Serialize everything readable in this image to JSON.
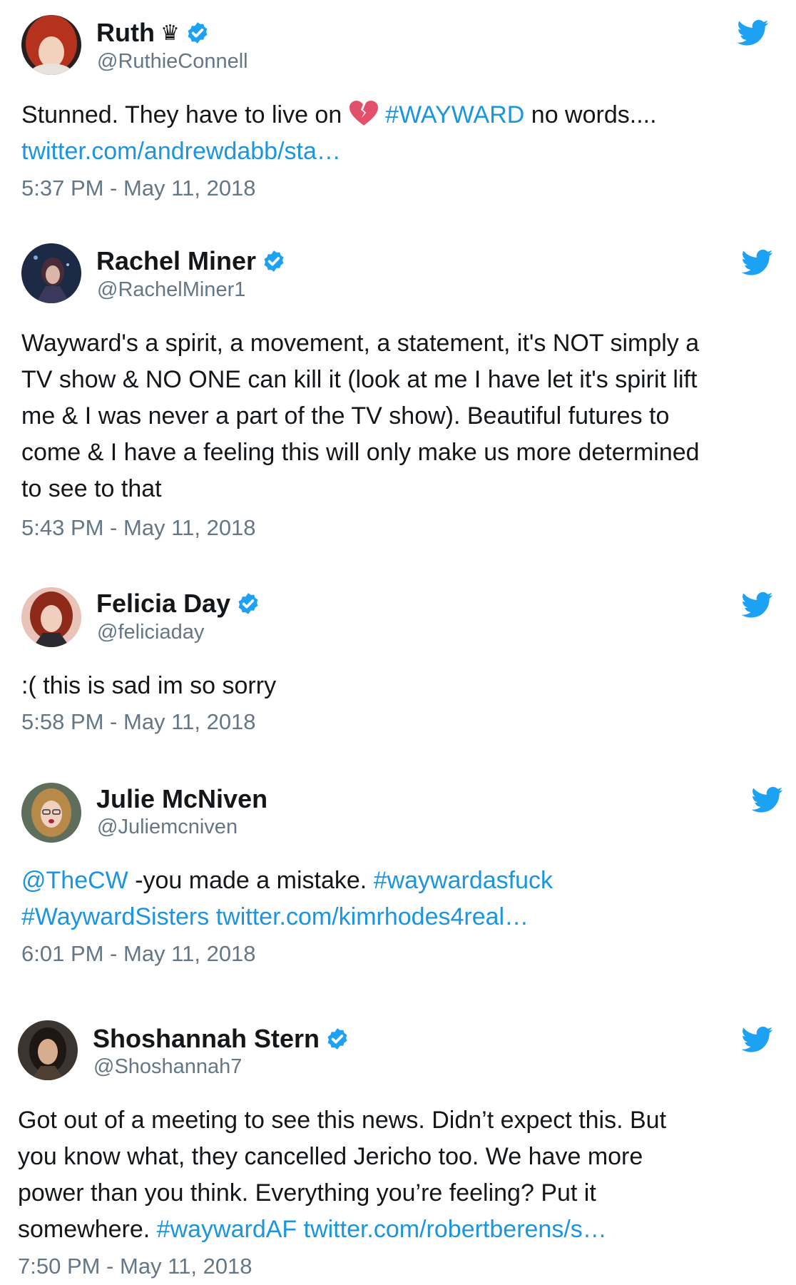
{
  "tweets": [
    {
      "name": "Ruth",
      "name_suffix": "♛",
      "handle": "@RuthieConnell",
      "text_1a": "Stunned. They have to live on",
      "hashtag_1": "#WAYWARD",
      "text_1b": "no words....",
      "link_1": "twitter.com/andrewdabb/sta…",
      "time": "5:37 PM - May 11, 2018"
    },
    {
      "name": "Rachel Miner",
      "handle": "@RachelMiner1",
      "lines": [
        "Wayward's a spirit, a movement, a statement, it's NOT simply a",
        "TV show & NO ONE can kill it (look at me I have let it's spirit lift",
        "me & I was never a part of the TV show). Beautiful futures to",
        "come & I have a feeling this will only make us more determined",
        "to see to that"
      ],
      "time": "5:43 PM - May 11, 2018"
    },
    {
      "name": "Felicia Day",
      "handle": "@feliciaday",
      "text": ":( this is sad im so sorry",
      "time": "5:58 PM - May 11, 2018"
    },
    {
      "name": "Julie McNiven",
      "handle": "@Juliemcniven",
      "mention": "@TheCW",
      "text_1": "-you made a mistake.",
      "hashtag_1": "#waywardasfuck",
      "hashtag_2": "#WaywardSisters",
      "link": "twitter.com/kimrhodes4real…",
      "time": "6:01 PM - May 11, 2018"
    },
    {
      "name": "Shoshannah Stern",
      "handle": "@Shoshannah7",
      "lines": [
        "Got out of a meeting to see this news. Didn’t expect this. But",
        "you know what, they cancelled Jericho too. We have more",
        "power than you think. Everything you’re feeling? Put it"
      ],
      "text_last": "somewhere.",
      "hashtag": "#waywardAF",
      "link": "twitter.com/robertberens/s…",
      "time": "7:50 PM - May 11, 2018"
    }
  ],
  "icons": {
    "verified": "verified-badge-icon",
    "bird": "twitter-bird-icon",
    "broken_heart": "broken-heart-emoji"
  },
  "colors": {
    "link": "#1b95e0",
    "secondary": "#657786",
    "verified": "#1da1f2"
  }
}
